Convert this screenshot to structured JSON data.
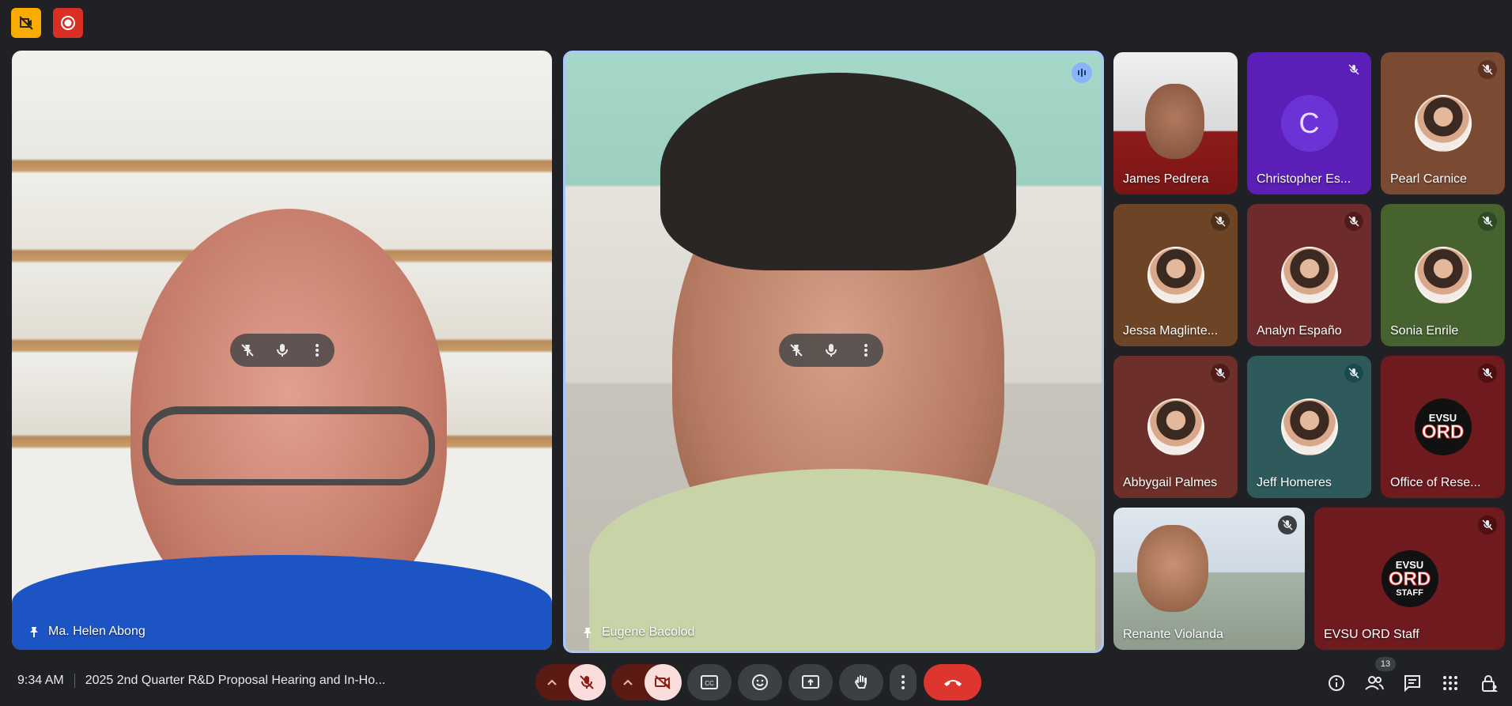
{
  "meeting": {
    "time": "9:34 AM",
    "title": "2025 2nd Quarter R&D Proposal Hearing and In-Ho...",
    "participant_count": "13"
  },
  "featured": [
    {
      "name": "Ma. Helen Abong",
      "pinned": true
    },
    {
      "name": "Eugene Bacolod",
      "pinned": true,
      "speaking": true
    }
  ],
  "grid": [
    {
      "name": "James Pedrera",
      "kind": "video",
      "muted": false
    },
    {
      "name": "Christopher Es...",
      "kind": "letter",
      "letter": "C",
      "muted": true,
      "badge_color": "#5b1fb8"
    },
    {
      "name": "Pearl Carnice",
      "kind": "avatar",
      "muted": true,
      "badge_color": "#6b3b26"
    },
    {
      "name": "Jessa Maglinte...",
      "kind": "avatar",
      "muted": true,
      "badge_color": "#5e3a1e"
    },
    {
      "name": "Analyn Españo",
      "kind": "avatar",
      "muted": true,
      "badge_color": "#5b1e1e"
    },
    {
      "name": "Sonia Enrile",
      "kind": "avatar",
      "muted": true,
      "badge_color": "#2f4a22"
    },
    {
      "name": "Abbygail Palmes",
      "kind": "avatar",
      "muted": true,
      "badge_color": "#5e1f1c"
    },
    {
      "name": "Jeff Homeres",
      "kind": "avatar",
      "muted": true,
      "badge_color": "#1b4a4d"
    },
    {
      "name": "Office of Rese...",
      "kind": "logo",
      "logo_top": "EVSU",
      "logo_main": "ORD",
      "logo_sub": "",
      "muted": true,
      "badge_color": "#5c1014"
    },
    {
      "name": "Renante Violanda",
      "kind": "video",
      "muted": true,
      "badge_color": "#3c4043"
    },
    {
      "name": "EVSU ORD Staff",
      "kind": "logo",
      "logo_top": "EVSU",
      "logo_main": "ORD",
      "logo_sub": "STAFF",
      "muted": true,
      "badge_color": "#5c1014"
    }
  ],
  "colors": {
    "background": "#202124",
    "speaking_border": "#a8c7fa",
    "end_call": "#dc362e",
    "muted_control": "#f9dedc"
  },
  "controls": [
    "mic-toggle-muted",
    "camera-toggle-off",
    "captions",
    "emoji-reactions",
    "present-screen",
    "raise-hand",
    "more-options",
    "leave-call"
  ],
  "right_controls": [
    "meeting-details",
    "people",
    "chat",
    "activities",
    "host-controls"
  ]
}
